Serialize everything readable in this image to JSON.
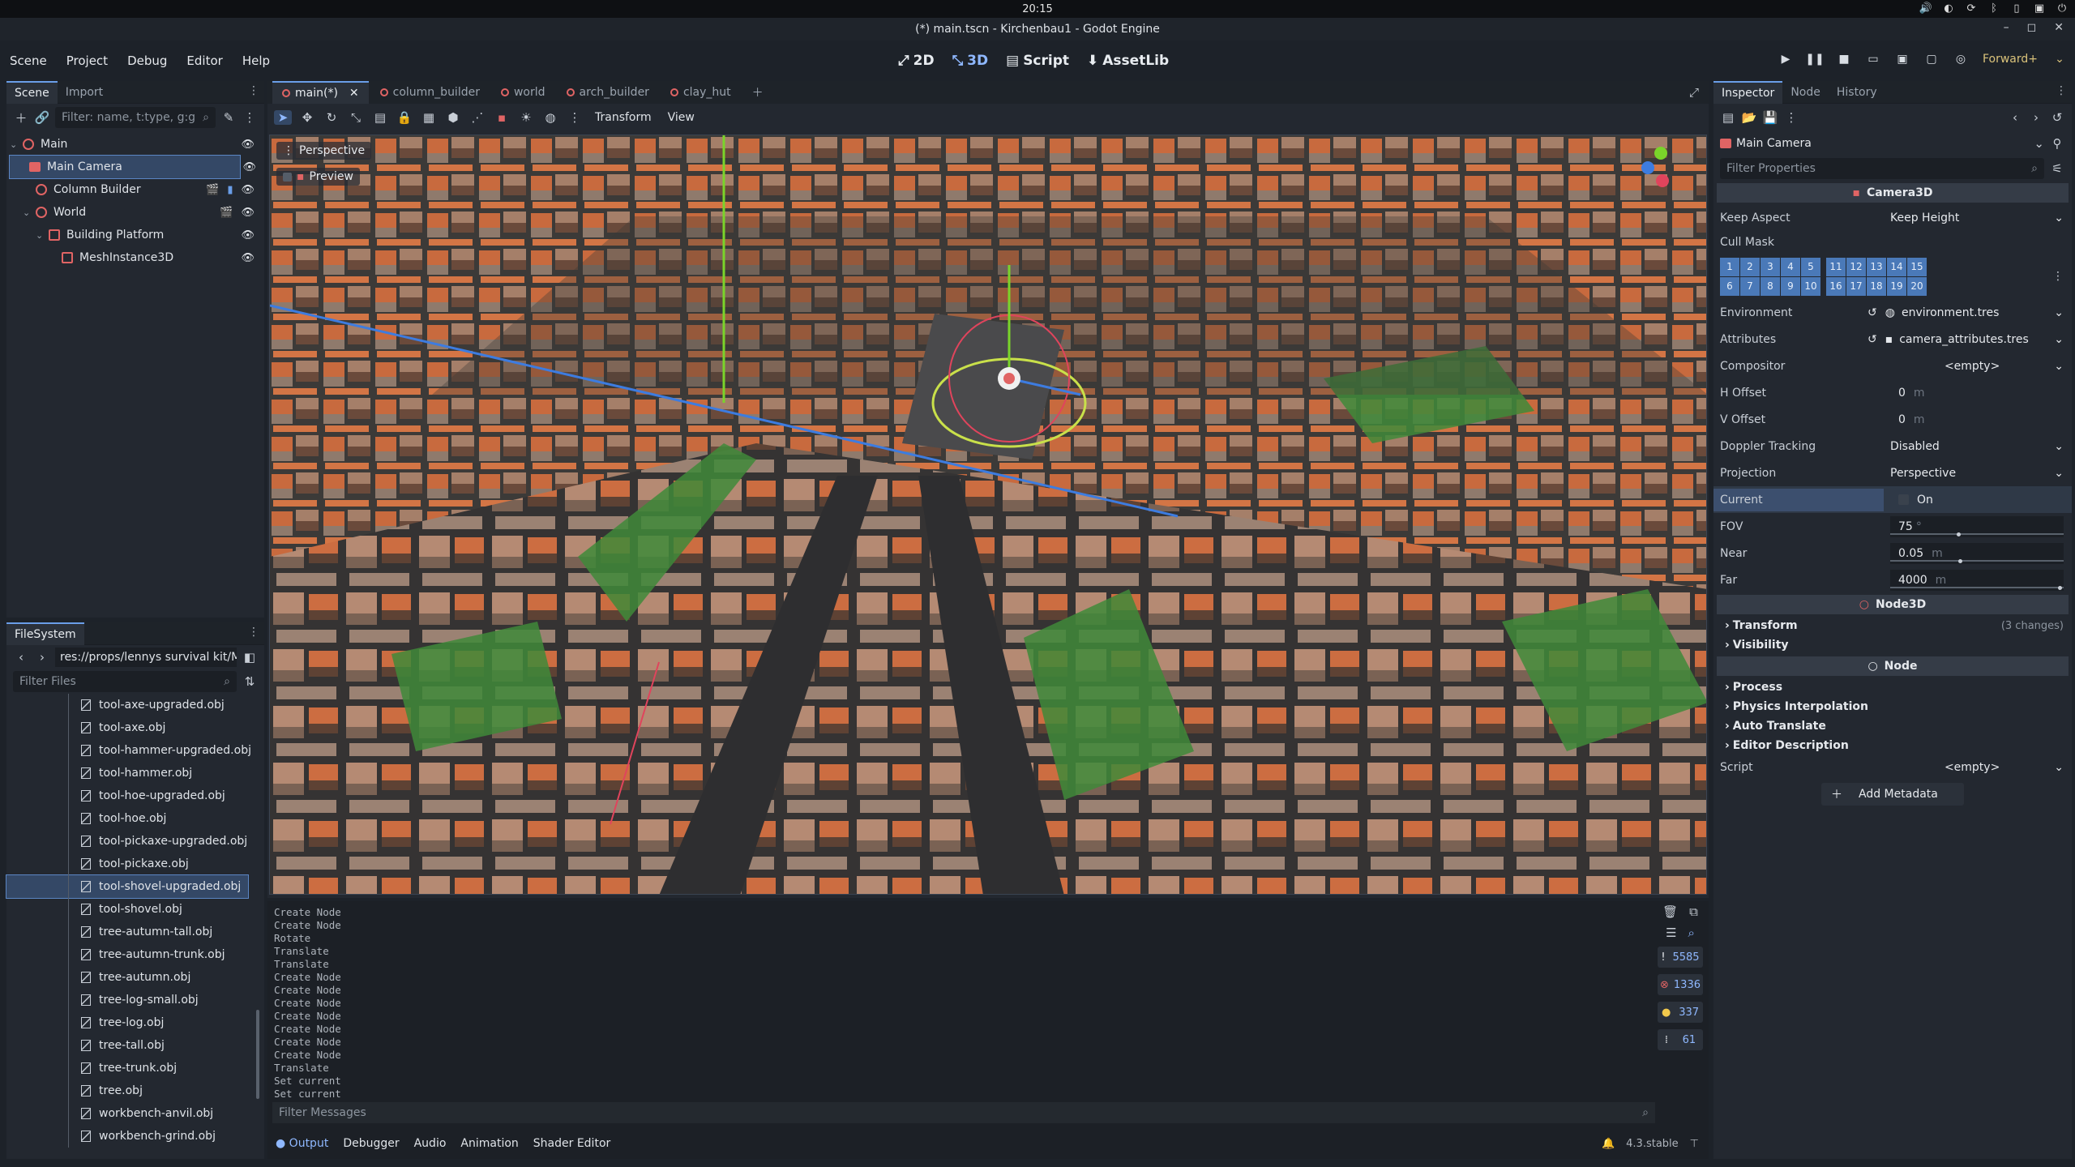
{
  "os": {
    "clock": "20:15"
  },
  "window": {
    "title": "(*) main.tscn - Kirchenbau1 - Godot Engine"
  },
  "menu": [
    "Scene",
    "Project",
    "Debug",
    "Editor",
    "Help"
  ],
  "main_screens": [
    {
      "label": "2D",
      "icon": "2d-icon"
    },
    {
      "label": "3D",
      "icon": "3d-icon",
      "active": true
    },
    {
      "label": "Script",
      "icon": "script-icon"
    },
    {
      "label": "AssetLib",
      "icon": "assetlib-icon"
    }
  ],
  "renderer": "Forward+",
  "scene_dock": {
    "tabs": [
      "Scene",
      "Import"
    ],
    "filter_placeholder": "Filter: name, t:type, g:g",
    "nodes": [
      {
        "label": "Main",
        "depth": 0,
        "icon": "node3d-icon"
      },
      {
        "label": "Main Camera",
        "depth": 1,
        "icon": "camera-icon",
        "selected": true
      },
      {
        "label": "Column Builder",
        "depth": 1,
        "icon": "node3d-icon"
      },
      {
        "label": "World",
        "depth": 1,
        "icon": "node3d-icon"
      },
      {
        "label": "Building Platform",
        "depth": 2,
        "icon": "staticbody-icon"
      },
      {
        "label": "MeshInstance3D",
        "depth": 3,
        "icon": "mesh-icon"
      }
    ]
  },
  "filesystem": {
    "tab": "FileSystem",
    "path": "res://props/lennys survival kit/Mod",
    "filter_placeholder": "Filter Files",
    "files": [
      "tool-axe-upgraded.obj",
      "tool-axe.obj",
      "tool-hammer-upgraded.obj",
      "tool-hammer.obj",
      "tool-hoe-upgraded.obj",
      "tool-hoe.obj",
      "tool-pickaxe-upgraded.obj",
      "tool-pickaxe.obj",
      "tool-shovel-upgraded.obj",
      "tool-shovel.obj",
      "tree-autumn-tall.obj",
      "tree-autumn-trunk.obj",
      "tree-autumn.obj",
      "tree-log-small.obj",
      "tree-log.obj",
      "tree-tall.obj",
      "tree-trunk.obj",
      "tree.obj",
      "workbench-anvil.obj",
      "workbench-grind.obj"
    ],
    "selected_file": "tool-shovel-upgraded.obj"
  },
  "scene_tabs": [
    {
      "label": "main(*)",
      "active": true
    },
    {
      "label": "column_builder"
    },
    {
      "label": "world"
    },
    {
      "label": "arch_builder"
    },
    {
      "label": "clay_hut"
    }
  ],
  "viewport": {
    "menus": [
      "Transform",
      "View"
    ],
    "perspective_label": "Perspective",
    "preview_label": "Preview"
  },
  "output": {
    "lines": [
      "Create Node",
      "Create Node",
      "Rotate",
      "Translate",
      "Translate",
      "Create Node",
      "Create Node",
      "Create Node",
      "Create Node",
      "Create Node",
      "Create Node",
      "Create Node",
      "Translate",
      "Set current",
      "Set current"
    ],
    "counts": {
      "messages": "5585",
      "errors": "1336",
      "warnings": "337",
      "info": "61"
    },
    "filter_placeholder": "Filter Messages",
    "tabs": [
      "Output",
      "Debugger",
      "Audio",
      "Animation",
      "Shader Editor"
    ],
    "version": "4.3.stable"
  },
  "inspector": {
    "tabs": [
      "Inspector",
      "Node",
      "History"
    ],
    "object": "Main Camera",
    "filter_placeholder": "Filter Properties",
    "class_header": "Camera3D",
    "properties": {
      "keep_aspect": {
        "label": "Keep Aspect",
        "value": "Keep Height"
      },
      "cull_mask": {
        "label": "Cull Mask",
        "layers": [
          "1",
          "2",
          "3",
          "4",
          "5",
          "11",
          "12",
          "13",
          "14",
          "15",
          "6",
          "7",
          "8",
          "9",
          "10",
          "16",
          "17",
          "18",
          "19",
          "20"
        ]
      },
      "environment": {
        "label": "Environment",
        "value": "environment.tres"
      },
      "attributes": {
        "label": "Attributes",
        "value": "camera_attributes.tres"
      },
      "compositor": {
        "label": "Compositor",
        "value": "<empty>"
      },
      "h_offset": {
        "label": "H Offset",
        "value": "0",
        "unit": "m"
      },
      "v_offset": {
        "label": "V Offset",
        "value": "0",
        "unit": "m"
      },
      "doppler": {
        "label": "Doppler Tracking",
        "value": "Disabled"
      },
      "projection": {
        "label": "Projection",
        "value": "Perspective"
      },
      "current": {
        "label": "Current",
        "value": "On"
      },
      "fov": {
        "label": "FOV",
        "value": "75",
        "unit": "°"
      },
      "near": {
        "label": "Near",
        "value": "0.05",
        "unit": "m"
      },
      "far": {
        "label": "Far",
        "value": "4000",
        "unit": "m"
      }
    },
    "node3d_header": "Node3D",
    "transform_group": "Transform",
    "transform_changes": "(3 changes)",
    "visibility_group": "Visibility",
    "node_header": "Node",
    "node_groups": [
      "Process",
      "Physics Interpolation",
      "Auto Translate",
      "Editor Description"
    ],
    "script": {
      "label": "Script",
      "value": "<empty>"
    },
    "add_metadata": "Add Metadata"
  }
}
